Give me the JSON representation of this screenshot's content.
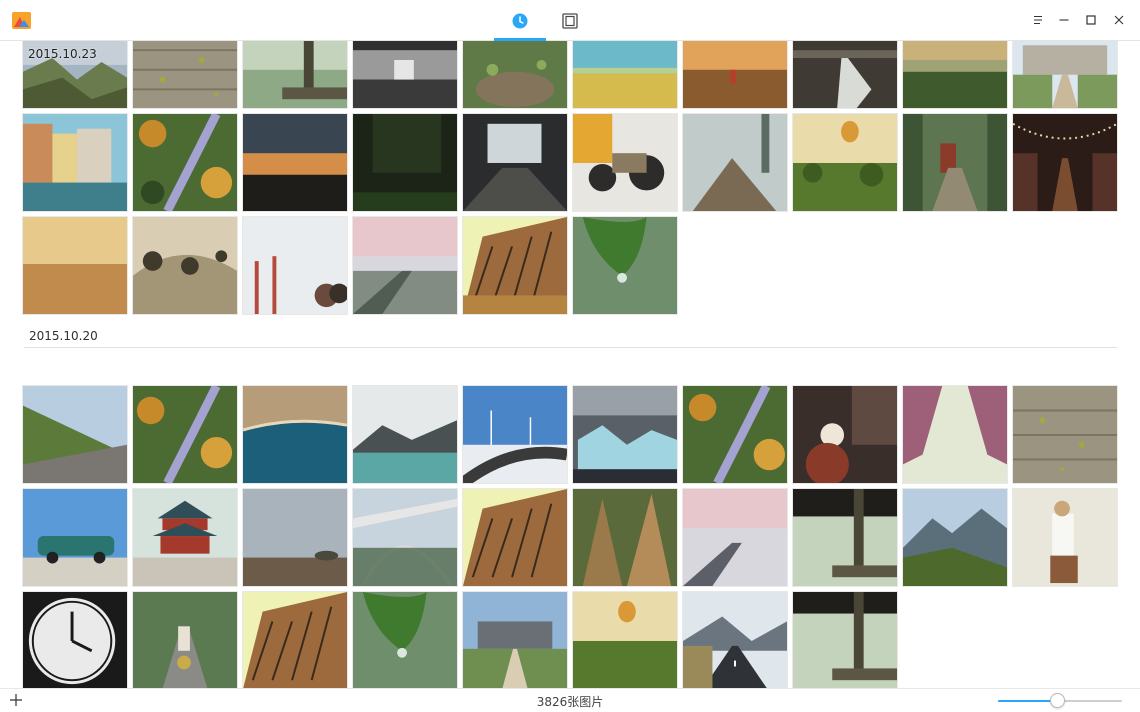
{
  "window": {
    "title_icon": "deepin-album-logo",
    "tabs": [
      {
        "id": "timeline",
        "icon": "clock-icon",
        "active": true
      },
      {
        "id": "albums",
        "icon": "album-icon",
        "active": false
      }
    ],
    "controls": [
      "menu-icon",
      "minimize-icon",
      "maximize-icon",
      "close-icon"
    ]
  },
  "sections": [
    {
      "date": "2015.10.23",
      "photo_count": 26
    },
    {
      "date": "2015.10.20",
      "photo_count": 28
    }
  ],
  "status": {
    "photo_count_text": "3826张图片"
  },
  "zoom": {
    "level": 0.48
  },
  "colors": {
    "accent": "#2ca7f8",
    "divider": "#e1e1e1"
  }
}
